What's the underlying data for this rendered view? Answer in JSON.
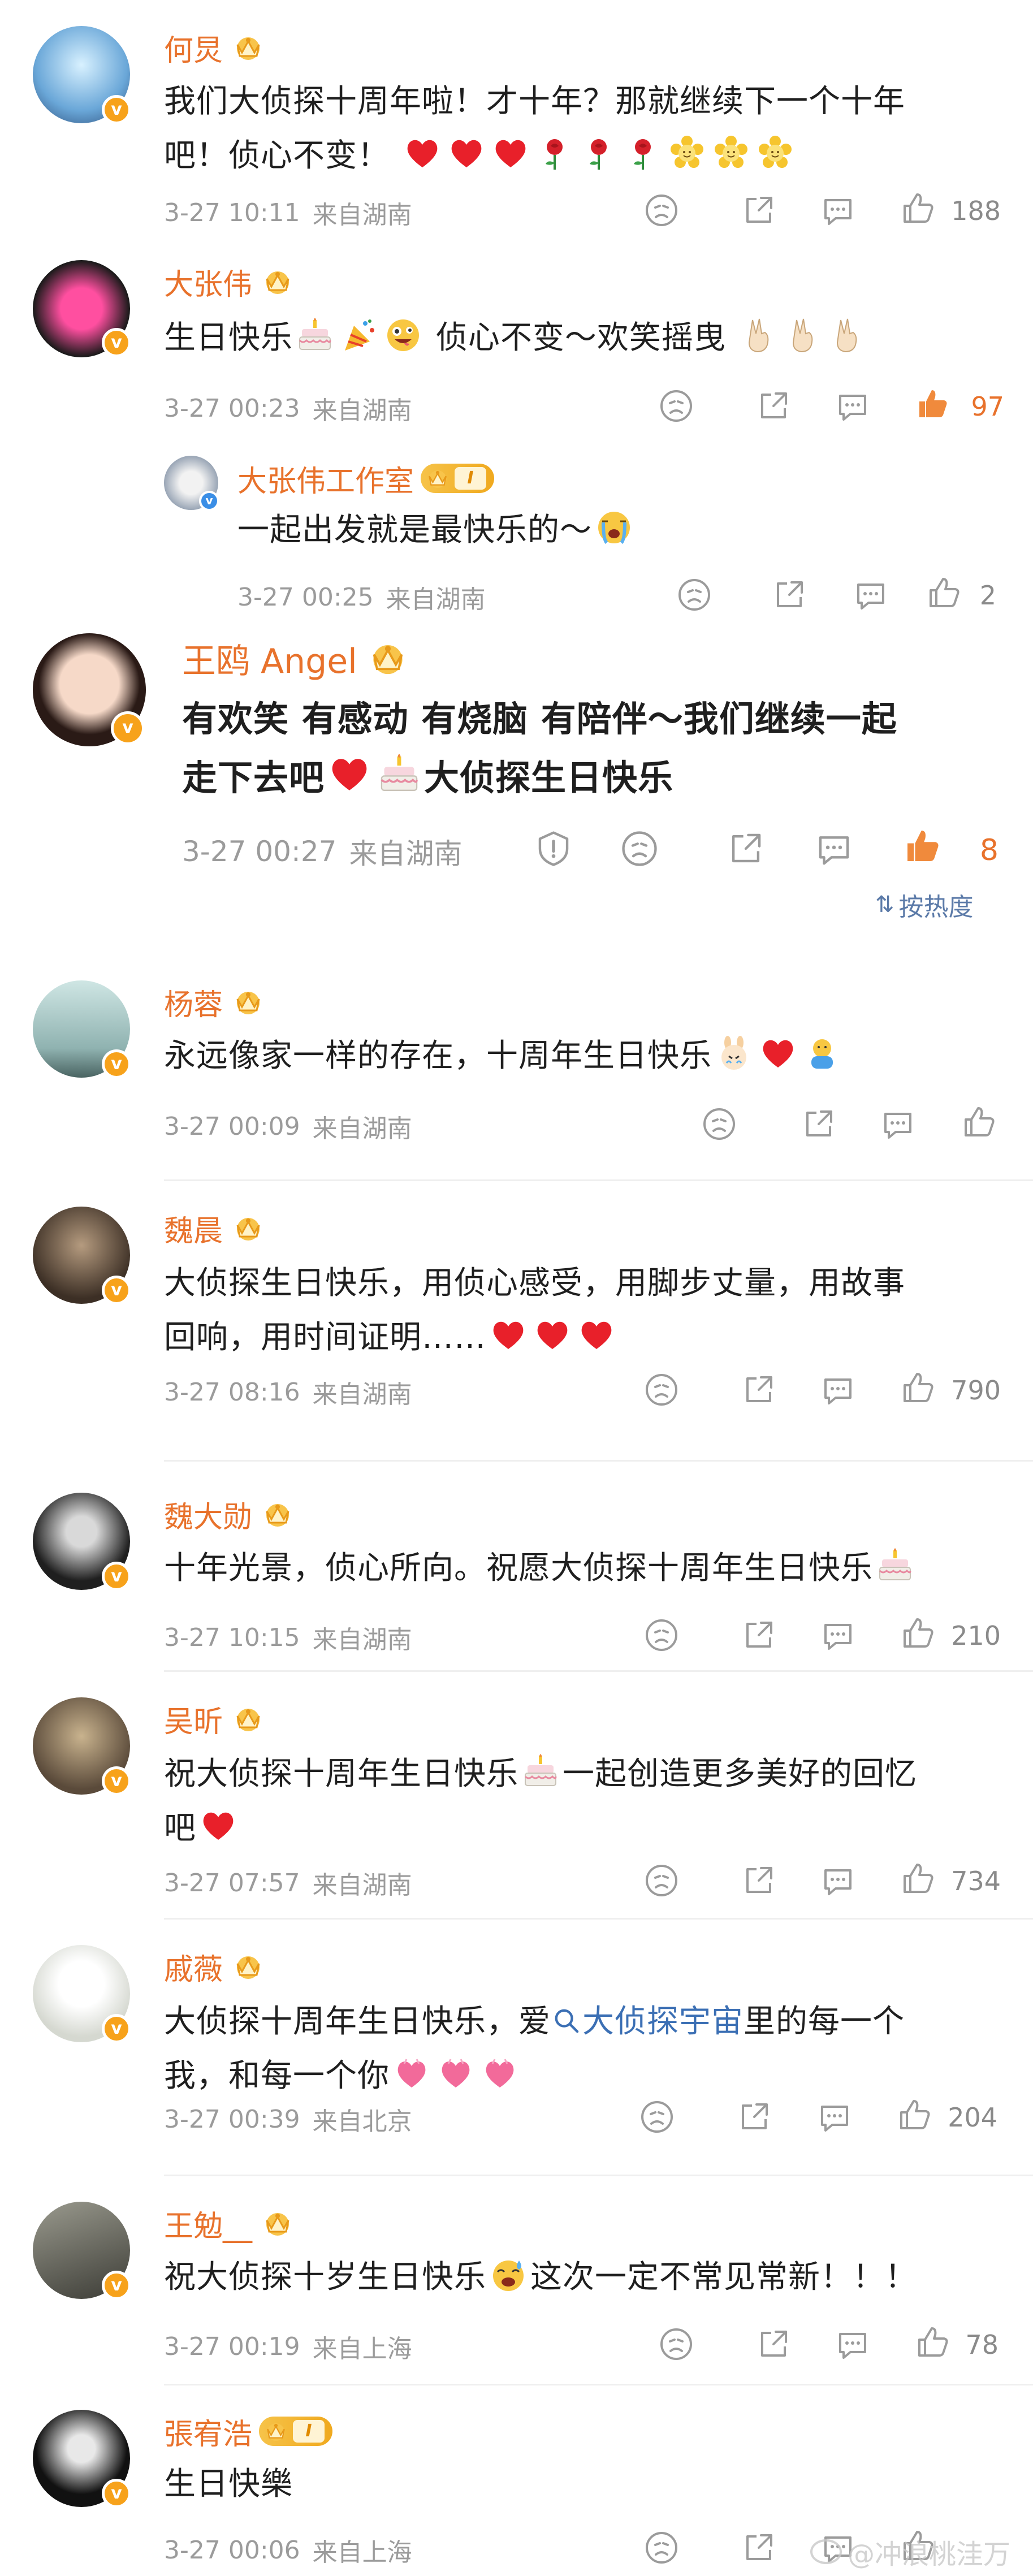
{
  "colors": {
    "name": "#e8722c",
    "meta": "#9b9b9b",
    "like_active": "#e8722c",
    "link": "#3b6fb4"
  },
  "sort": {
    "label": "按热度"
  },
  "watermark": "@冲浪桃洼万",
  "comments": [
    {
      "name": "何炅",
      "badge": "crown",
      "text_lines": [
        "我们大侦探十周年啦！才十年？那就继续下一个十年",
        "吧！侦心不变！"
      ],
      "date": "3-27 10:11",
      "location": "来自湖南",
      "likes": "188",
      "liked": false
    },
    {
      "name": "大张伟",
      "badge": "crown",
      "text_a": "生日快乐",
      "text_b": "侦心不变～欢笑摇曳",
      "date": "3-27 00:23",
      "location": "来自湖南",
      "likes": "97",
      "liked": true
    },
    {
      "name": "大张伟工作室",
      "badge": "vip",
      "vip_level": "I",
      "text": "一起出发就是最快乐的～",
      "date": "3-27 00:25",
      "location": "来自湖南",
      "likes": "2",
      "liked": false
    },
    {
      "name": "王鸥 Angel",
      "badge": "crown",
      "text_line1": "有欢笑 有感动 有烧脑 有陪伴～我们继续一起",
      "text_line2": "走下去吧",
      "text_line2b": "大侦探生日快乐",
      "date": "3-27 00:27",
      "location": "来自湖南",
      "likes": "8",
      "liked": true
    },
    {
      "name": "杨蓉",
      "badge": "crown",
      "text": "永远像家一样的存在，十周年生日快乐",
      "date": "3-27 00:09",
      "location": "来自湖南",
      "likes": "",
      "liked": false
    },
    {
      "name": "魏晨",
      "badge": "crown",
      "text_lines": [
        "大侦探生日快乐，用侦心感受，用脚步丈量，用故事",
        "回响，用时间证明……"
      ],
      "date": "3-27 08:16",
      "location": "来自湖南",
      "likes": "790",
      "liked": false
    },
    {
      "name": "魏大勋",
      "badge": "crown",
      "text": "十年光景，侦心所向。祝愿大侦探十周年生日快乐",
      "date": "3-27 10:15",
      "location": "来自湖南",
      "likes": "210",
      "liked": false
    },
    {
      "name": "吴昕",
      "badge": "crown",
      "text_a": "祝大侦探十周年生日快乐",
      "text_b": "一起创造更多美好的回忆",
      "text_c": "吧",
      "date": "3-27 07:57",
      "location": "来自湖南",
      "likes": "734",
      "liked": false
    },
    {
      "name": "戚薇",
      "badge": "crown",
      "text_a": "大侦探十周年生日快乐，爱",
      "link": "大侦探宇宙",
      "text_b": "里的每一个",
      "text_c": "我，和每一个你",
      "date": "3-27 00:39",
      "location": "来自北京",
      "likes": "204",
      "liked": false
    },
    {
      "name": "王勉__",
      "badge": "crown",
      "text_a": "祝大侦探十岁生日快乐",
      "text_b": "这次一定不常见常新！！！",
      "date": "3-27 00:19",
      "location": "来自上海",
      "likes": "78",
      "liked": false
    },
    {
      "name": "張宥浩",
      "badge": "vip",
      "vip_level": "I",
      "text": "生日快樂",
      "date": "3-27 00:06",
      "location": "来自上海",
      "likes": "",
      "liked": false
    }
  ]
}
